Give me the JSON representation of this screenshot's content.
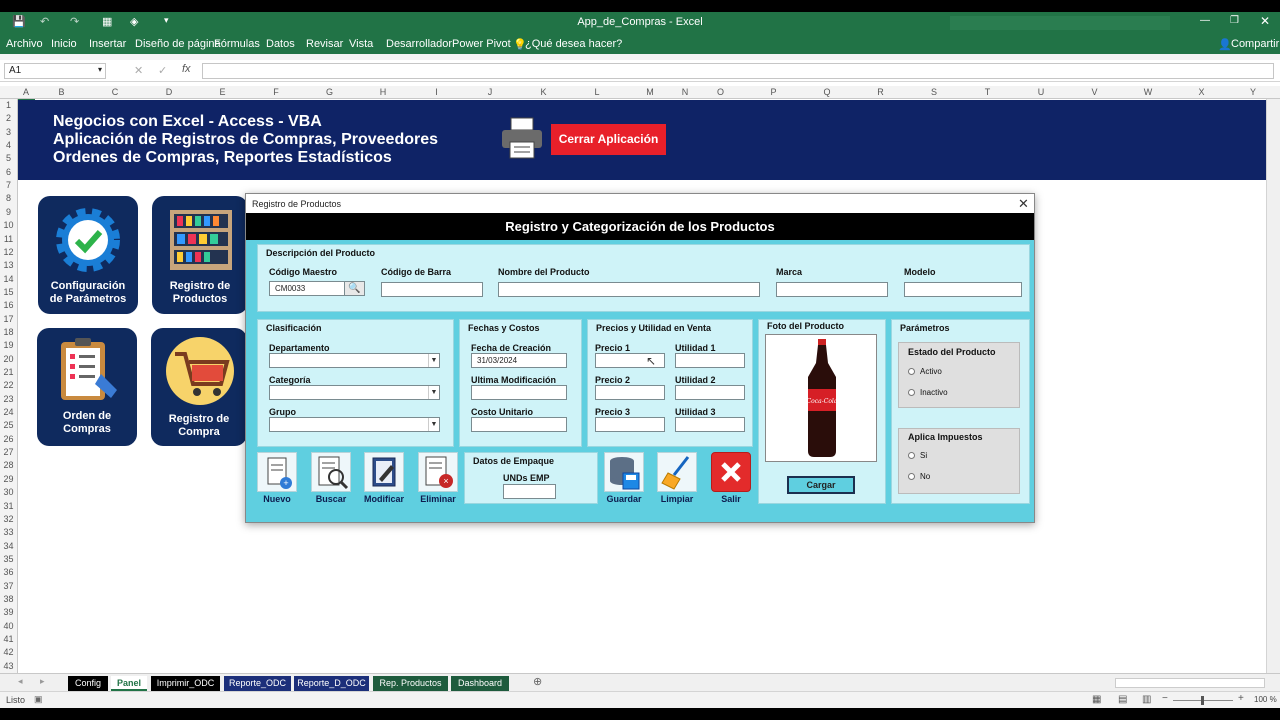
{
  "window": {
    "title": "App_de_Compras - Excel",
    "share": "Compartir"
  },
  "ribbon": {
    "tabs": [
      "Archivo",
      "Inicio",
      "Insertar",
      "Diseño de página",
      "Fórmulas",
      "Datos",
      "Revisar",
      "Vista",
      "Desarrollador",
      "Power Pivot"
    ],
    "tell_me": "¿Qué desea hacer?"
  },
  "formula": {
    "name_box": "A1"
  },
  "grid": {
    "columns": [
      "A",
      "B",
      "C",
      "D",
      "E",
      "F",
      "G",
      "H",
      "I",
      "J",
      "K",
      "L",
      "M",
      "N",
      "O",
      "P",
      "Q",
      "R",
      "S",
      "T",
      "U",
      "V",
      "W",
      "X",
      "Y"
    ],
    "rows": [
      "1",
      "2",
      "3",
      "4",
      "5",
      "6",
      "7",
      "8",
      "9",
      "10",
      "11",
      "12",
      "13",
      "14",
      "15",
      "16",
      "17",
      "18",
      "19",
      "20",
      "21",
      "22",
      "23",
      "24",
      "25",
      "26",
      "27",
      "28",
      "29",
      "30",
      "31",
      "32",
      "33",
      "34",
      "35",
      "36",
      "37",
      "38",
      "39",
      "40",
      "41",
      "42",
      "43"
    ]
  },
  "banner": {
    "line1": "Negocios con Excel - Access - VBA",
    "line2": "Aplicación de Registros de Compras, Proveedores",
    "line3": "Ordenes de Compras, Reportes Estadísticos",
    "close_button": "Cerrar Aplicación"
  },
  "panel_buttons": {
    "config_1": "Configuración",
    "config_2": "de Parámetros",
    "productos_1": "Registro de",
    "productos_2": "Productos",
    "ordenes_1": "Orden de",
    "ordenes_2": "Compras",
    "compra_1": "Registro de",
    "compra_2": "Compra"
  },
  "dialog": {
    "title": "Registro de Productos",
    "header": "Registro y Categorización de los Productos",
    "descripcion": {
      "title": "Descripción del Producto",
      "codigo_maestro": "Código Maestro",
      "codigo_maestro_value": "CM0033",
      "codigo_barra": "Código de Barra",
      "nombre": "Nombre del Producto",
      "marca": "Marca",
      "modelo": "Modelo"
    },
    "clasificacion": {
      "title": "Clasificación",
      "departamento": "Departamento",
      "categoria": "Categoría",
      "grupo": "Grupo"
    },
    "fechas": {
      "title": "Fechas y Costos",
      "creacion": "Fecha de Creación",
      "creacion_value": "31/03/2024",
      "modificacion": "Ultima Modificación",
      "costo": "Costo Unitario"
    },
    "precios": {
      "title": "Precios y Utilidad en Venta",
      "p1": "Precio 1",
      "u1": "Utilidad 1",
      "p2": "Precio 2",
      "u2": "Utilidad 2",
      "p3": "Precio 3",
      "u3": "Utilidad 3"
    },
    "foto": {
      "title": "Foto del Producto",
      "cargar": "Cargar"
    },
    "parametros": {
      "title": "Parámetros",
      "estado": "Estado del Producto",
      "activo": "Activo",
      "inactivo": "Inactivo",
      "impuestos": "Aplica Impuestos",
      "si": "Si",
      "no": "No"
    },
    "empaque": {
      "title": "Datos de Empaque",
      "unds": "UNDs EMP"
    },
    "actions": {
      "nuevo": "Nuevo",
      "buscar": "Buscar",
      "modificar": "Modificar",
      "eliminar": "Eliminar",
      "guardar": "Guardar",
      "limpiar": "Limpiar",
      "salir": "Salir"
    }
  },
  "sheet_tabs": [
    "Config",
    "Panel",
    "Imprimir_ODC",
    "Reporte_ODC",
    "Reporte_D_ODC",
    "Rep. Productos",
    "Dashboard"
  ],
  "status": {
    "ready": "Listo",
    "zoom": "100 %"
  },
  "colors": {
    "excel_green": "#217346",
    "banner": "#0f2366",
    "dialog_body": "#5fcfe0",
    "close": "#e8202a"
  }
}
